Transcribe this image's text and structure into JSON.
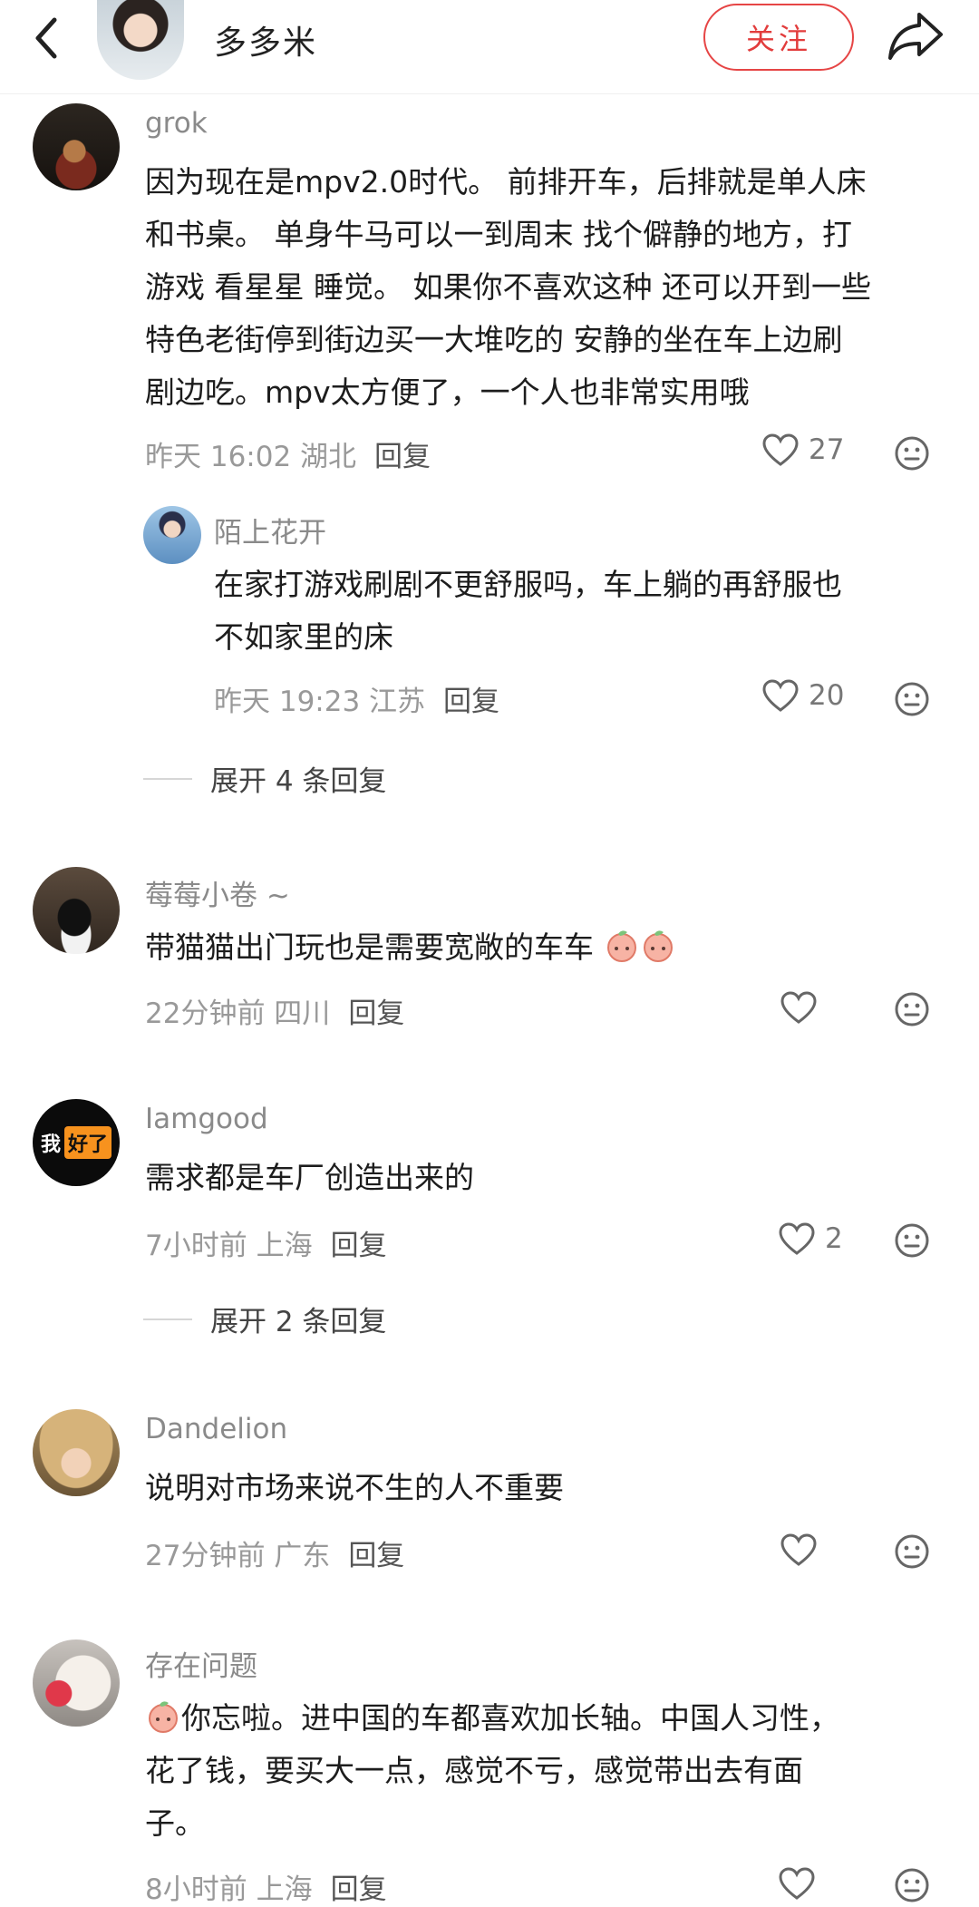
{
  "header": {
    "title": "多多米",
    "follow_label": "关注"
  },
  "comments": [
    {
      "user": "grok",
      "lines": [
        "因为现在是mpv2.0时代。 前排开车，后排就是单人床",
        "和书桌。 单身牛马可以一到周末 找个僻静的地方，打",
        "游戏 看星星 睡觉。 如果你不喜欢这种 还可以开到一些",
        "特色老街停到街边买一大堆吃的 安静的坐在车上边刷",
        "剧边吃。mpv太方便了，一个人也非常实用哦"
      ],
      "time": "昨天 16:02 湖北",
      "reply_label": "回复",
      "likes": "27"
    },
    {
      "user": "陌上花开",
      "lines": [
        "在家打游戏刷剧不更舒服吗，车上躺的再舒服也",
        "不如家里的床"
      ],
      "time": "昨天 19:23 江苏",
      "reply_label": "回复",
      "likes": "20"
    },
    {
      "user": "莓莓小卷 ~",
      "lines": [
        "带猫猫出门玩也是需要宽敞的车车"
      ],
      "time": "22分钟前 四川",
      "reply_label": "回复",
      "likes": ""
    },
    {
      "user": "Iamgood",
      "lines": [
        "需求都是车厂创造出来的"
      ],
      "time": "7小时前 上海",
      "reply_label": "回复",
      "likes": "2"
    },
    {
      "user": "Dandelion",
      "lines": [
        "说明对市场来说不生的人不重要"
      ],
      "time": "27分钟前 广东",
      "reply_label": "回复",
      "likes": ""
    },
    {
      "user": "存在问题",
      "lines": [
        "你忘啦。进中国的车都喜欢加长轴。中国人习性，",
        "花了钱，要买大一点，感觉不亏，感觉带出去有面",
        "子。"
      ],
      "time": "8小时前 上海",
      "reply_label": "回复",
      "likes": ""
    }
  ],
  "expand_replies": [
    "展开 4 条回复",
    "展开 2 条回复"
  ],
  "iamgood_avatar_text": [
    "我",
    "好了"
  ],
  "colors": {
    "accent": "#e64545",
    "meta": "#999999",
    "text": "#1d1d1d"
  }
}
